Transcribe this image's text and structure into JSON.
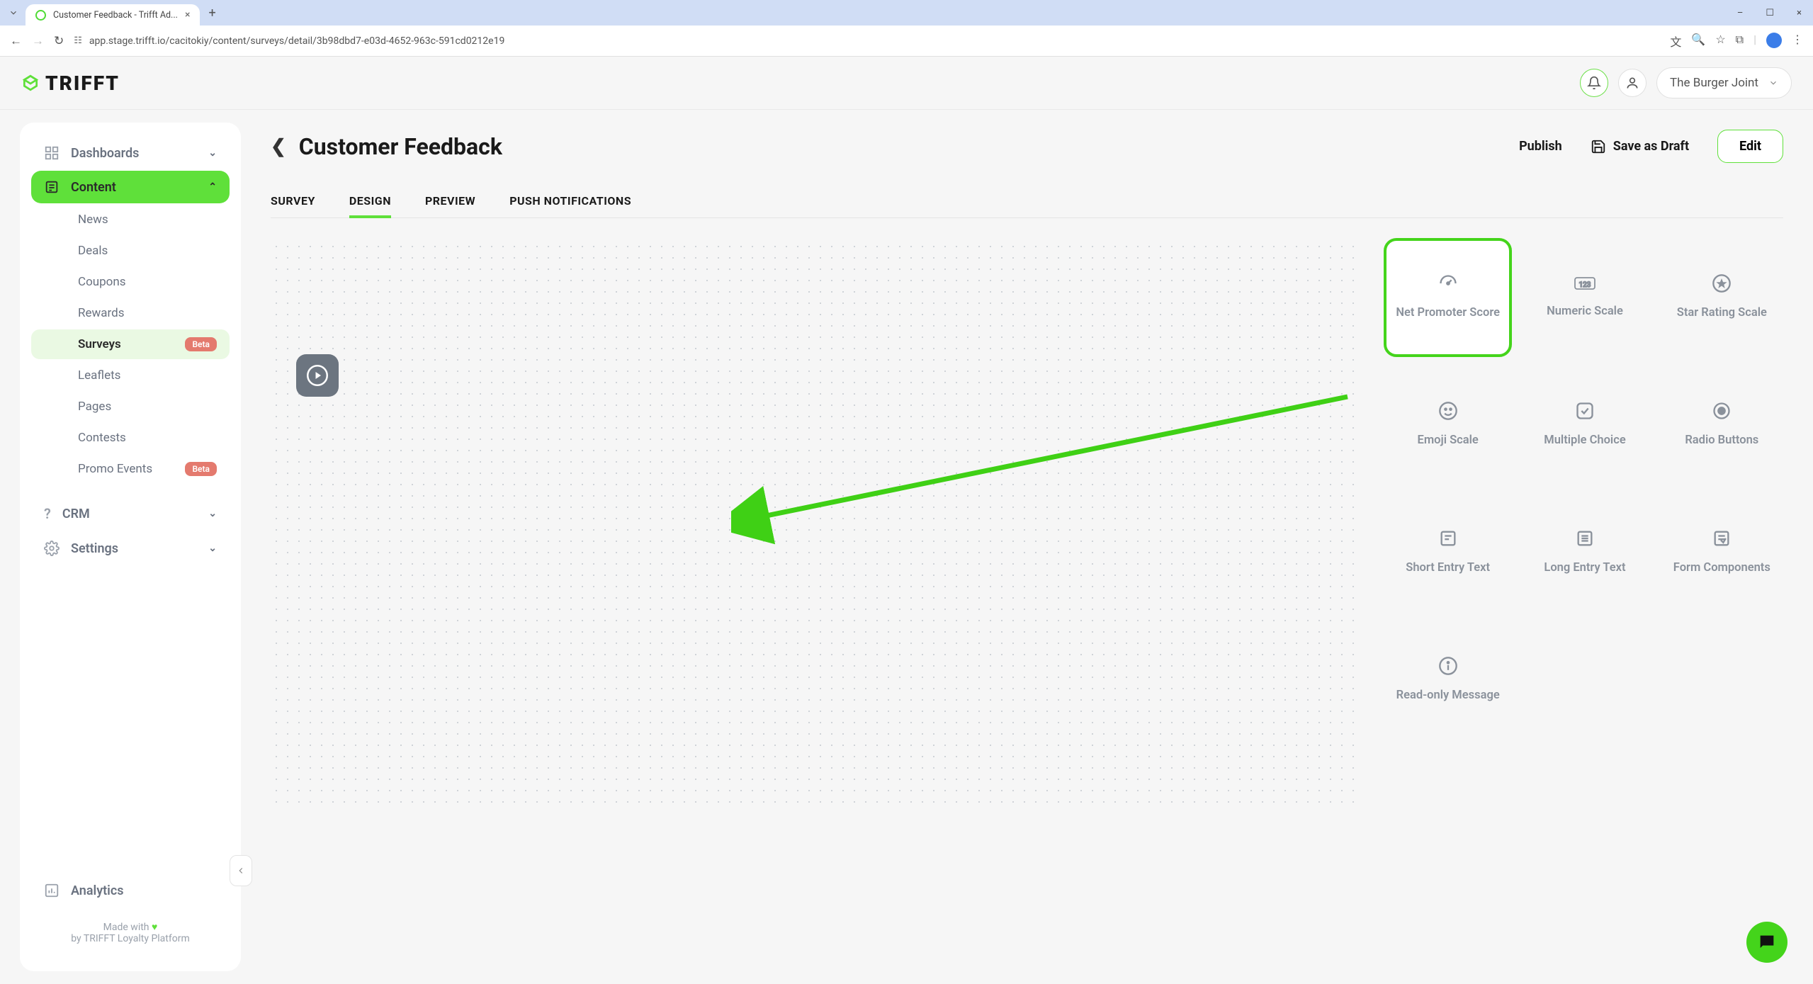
{
  "browser": {
    "tab_title": "Customer Feedback - Trifft Ad...",
    "url": "app.stage.trifft.io/cacitokiy/content/surveys/detail/3b98dbd7-e03d-4652-963c-591cd0212e19"
  },
  "topbar": {
    "brand": "TRIFFT",
    "org_name": "The Burger Joint"
  },
  "sidebar": {
    "dashboards": "Dashboards",
    "content": "Content",
    "content_items": [
      {
        "label": "News"
      },
      {
        "label": "Deals"
      },
      {
        "label": "Coupons"
      },
      {
        "label": "Rewards"
      },
      {
        "label": "Surveys",
        "active": true,
        "badge": "Beta"
      },
      {
        "label": "Leaflets"
      },
      {
        "label": "Pages"
      },
      {
        "label": "Contests"
      },
      {
        "label": "Promo Events",
        "badge": "Beta"
      }
    ],
    "crm": "CRM",
    "settings": "Settings",
    "analytics": "Analytics",
    "footer_line1": "Made with ",
    "footer_line2": "by TRIFFT Loyalty Platform"
  },
  "page": {
    "title": "Customer Feedback",
    "publish": "Publish",
    "save_draft": "Save as Draft",
    "edit": "Edit",
    "tabs": [
      "SURVEY",
      "DESIGN",
      "PREVIEW",
      "PUSH NOTIFICATIONS"
    ],
    "active_tab": 1
  },
  "widgets": [
    {
      "label": "Net Promoter Score",
      "icon": "gauge",
      "highlight": true
    },
    {
      "label": "Numeric Scale",
      "icon": "123"
    },
    {
      "label": "Star Rating Scale",
      "icon": "star"
    },
    {
      "label": "Emoji Scale",
      "icon": "smile"
    },
    {
      "label": "Multiple Choice",
      "icon": "check"
    },
    {
      "label": "Radio Buttons",
      "icon": "radio"
    },
    {
      "label": "Short Entry Text",
      "icon": "short"
    },
    {
      "label": "Long Entry Text",
      "icon": "long"
    },
    {
      "label": "Form Components",
      "icon": "form"
    },
    {
      "label": "Read-only Message",
      "icon": "info"
    }
  ]
}
